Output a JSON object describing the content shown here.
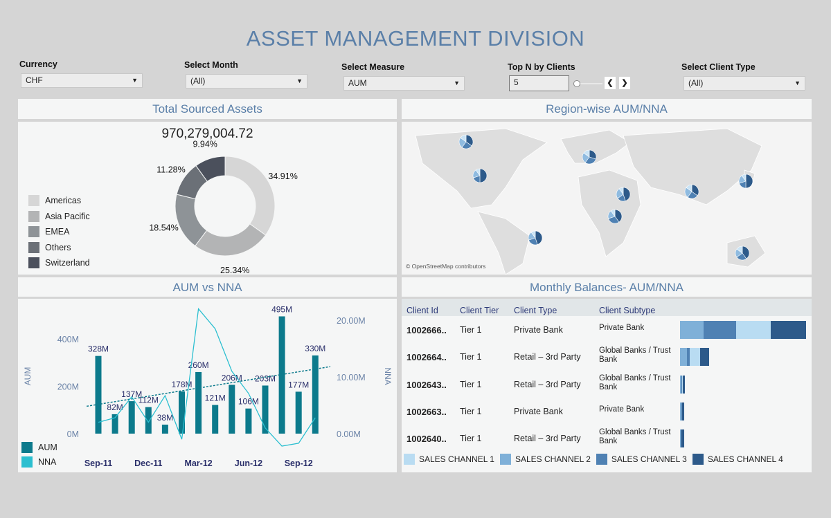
{
  "title": "ASSET MANAGEMENT DIVISION",
  "filters": {
    "currency": {
      "label": "Currency",
      "value": "CHF"
    },
    "month": {
      "label": "Select Month",
      "value": "(All)"
    },
    "measure": {
      "label": "Select Measure",
      "value": "AUM"
    },
    "topn": {
      "label": "Top N by Clients",
      "value": "5",
      "prev": "❮",
      "next": "❯"
    },
    "client_type": {
      "label": "Select Client Type",
      "value": "(All)"
    }
  },
  "total_assets": {
    "title": "Total Sourced Assets",
    "total": "970,279,004.72",
    "legend": [
      "Americas",
      "Asia Pacific",
      "EMEA",
      "Others",
      "Switzerland"
    ],
    "colors": [
      "#d6d6d6",
      "#b3b4b5",
      "#8e9397",
      "#6b7077",
      "#4b505c"
    ]
  },
  "region_map": {
    "title": "Region-wise AUM/NNA",
    "attribution": "© OpenStreetMap contributors",
    "pie_colors": [
      "#2d5a8a",
      "#4f81b3",
      "#8fbbe0",
      "#c9e3f5"
    ]
  },
  "aum_nna": {
    "title": "AUM vs NNA",
    "legend": [
      "AUM",
      "NNA"
    ],
    "colors": {
      "aum": "#0c7a8c",
      "nna": "#2bbfd0",
      "trend": "#0c7a8c"
    }
  },
  "monthly": {
    "title": "Monthly Balances- AUM/NNA",
    "columns": [
      "Client Id",
      "Client Tier",
      "Client Type",
      "Client Subtype"
    ],
    "rows": [
      {
        "id": "1002666..",
        "tier": "Tier 1",
        "type": "Private Bank",
        "subtype": "Private Bank",
        "bars": [
          50,
          34,
          47,
          51
        ]
      },
      {
        "id": "1002664..",
        "tier": "Tier 1",
        "type": "Retail – 3rd Party",
        "subtype": "Global Banks / Trust Bank",
        "bars": [
          15,
          10,
          4,
          13
        ]
      },
      {
        "id": "1002643..",
        "tier": "Tier 1",
        "type": "Retail – 3rd Party",
        "subtype": "Global Banks / Trust Bank",
        "bars": [
          1,
          2,
          1,
          3
        ]
      },
      {
        "id": "1002663..",
        "tier": "Tier 1",
        "type": "Private Bank",
        "subtype": "Private Bank",
        "bars": [
          0,
          2,
          1,
          3
        ]
      },
      {
        "id": "1002640..",
        "tier": "Tier 1",
        "type": "Retail – 3rd Party",
        "subtype": "Global Banks / Trust Bank",
        "bars": [
          0,
          1,
          1,
          4
        ]
      }
    ],
    "legend": [
      "SALES CHANNEL 1",
      "SALES CHANNEL 2",
      "SALES CHANNEL 3",
      "SALES CHANNEL 4"
    ],
    "colors": [
      "#b9dcf2",
      "#7fb0d8",
      "#4f81b3",
      "#2d5a8a"
    ]
  },
  "chart_data": [
    {
      "type": "pie",
      "title": "Total Sourced Assets",
      "categories": [
        "Americas",
        "Asia Pacific",
        "EMEA",
        "Others",
        "Switzerland"
      ],
      "values": [
        34.91,
        25.34,
        18.54,
        11.28,
        9.94
      ],
      "labels": [
        "34.91%",
        "25.34%",
        "18.54%",
        "11.28%",
        "9.94%"
      ],
      "legend": "left"
    },
    {
      "type": "bar",
      "title": "AUM vs NNA",
      "categories": [
        "Sep-11",
        "Oct-11",
        "Nov-11",
        "Dec-11",
        "Jan-12",
        "Feb-12",
        "Mar-12",
        "Apr-12",
        "May-12",
        "Jun-12",
        "Jul-12",
        "Aug-12",
        "Sep-12",
        "Oct-12"
      ],
      "tick_labels": [
        "Sep-11",
        "Dec-11",
        "Mar-12",
        "Jun-12",
        "Sep-12"
      ],
      "series": [
        {
          "name": "AUM",
          "type": "bar",
          "axis": "left",
          "values": [
            328,
            82,
            137,
            112,
            38,
            178,
            260,
            121,
            206,
            106,
            203,
            495,
            177,
            330
          ],
          "labels": [
            "328M",
            "82M",
            "137M",
            "112M",
            "38M",
            "178M",
            "260M",
            "121M",
            "206M",
            "106M",
            "203M",
            "495M",
            "177M",
            "330M"
          ]
        },
        {
          "name": "NNA",
          "type": "line",
          "axis": "right",
          "values": [
            2.0,
            2.8,
            6.5,
            2.0,
            6.7,
            -1.0,
            22.0,
            18.5,
            11.0,
            7.1,
            1.0,
            -2.2,
            -1.7,
            2.8
          ]
        }
      ],
      "trendline": "linear (AUM)",
      "ylabel": "AUM",
      "y2label": "NNA",
      "yticks": [
        "0M",
        "200M",
        "400M"
      ],
      "ylim": [
        0,
        560
      ],
      "y2ticks": [
        "0.00M",
        "10.00M",
        "20.00M"
      ],
      "y2lim": [
        -4,
        24
      ],
      "legend": "bottom-left"
    }
  ]
}
